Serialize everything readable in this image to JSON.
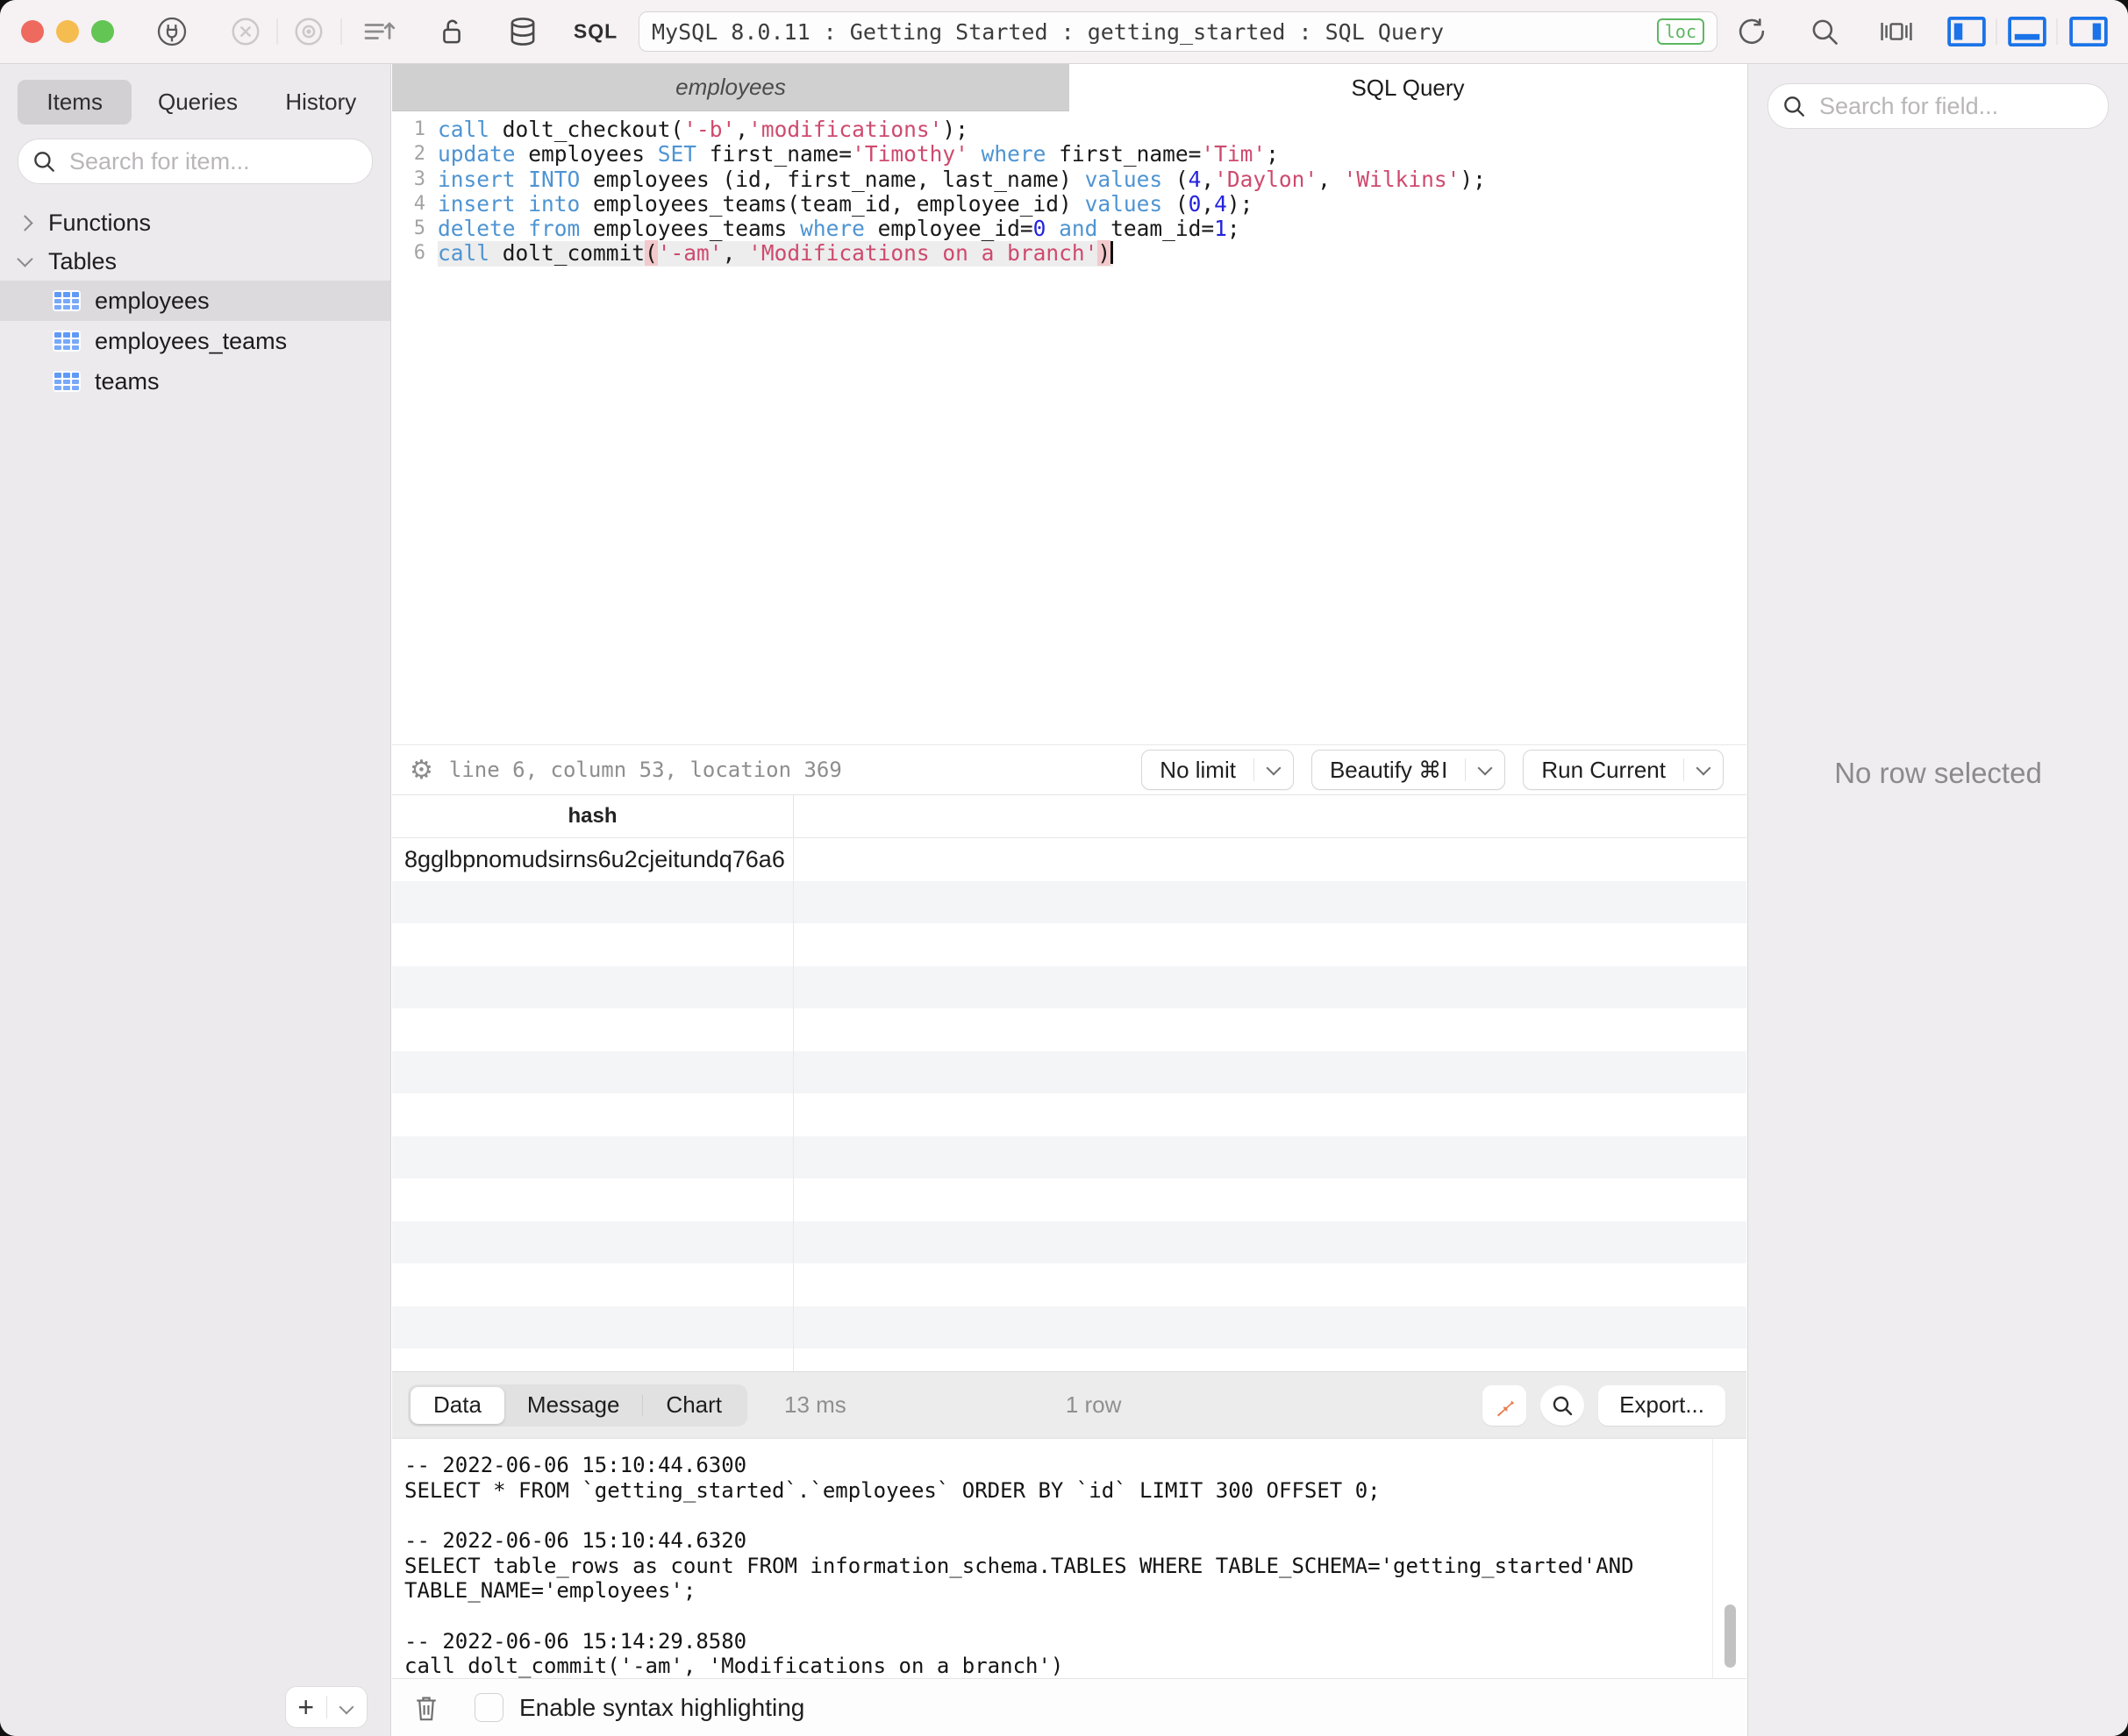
{
  "colors": {
    "kw": "#4e94d2",
    "str": "#ce4a6e",
    "num": "#2323dd",
    "parenbg": "#f3c9cc",
    "badge": "#5cb860",
    "accent": "#1a73e8",
    "pin": "#e87e52"
  },
  "window": {
    "title": "MySQL 8.0.11 : Getting Started : getting_started : SQL Query",
    "badge": "loc",
    "sql_glyph": "SQL"
  },
  "sidebar": {
    "tabs": [
      "Items",
      "Queries",
      "History"
    ],
    "active_tab": "Items",
    "search_placeholder": "Search for item...",
    "tree": [
      {
        "label": "Functions",
        "expanded": false,
        "children": []
      },
      {
        "label": "Tables",
        "expanded": true,
        "children": [
          {
            "label": "employees",
            "selected": true
          },
          {
            "label": "employees_teams",
            "selected": false
          },
          {
            "label": "teams",
            "selected": false
          }
        ]
      }
    ]
  },
  "editor": {
    "tabs": [
      {
        "label": "employees",
        "active": false
      },
      {
        "label": "SQL Query",
        "active": true
      }
    ],
    "status": "line 6, column 53, location 369",
    "buttons": [
      {
        "label": "No limit"
      },
      {
        "label": "Beautify ⌘I"
      },
      {
        "label": "Run Current"
      }
    ],
    "lines": [
      {
        "n": 1,
        "current": false,
        "tokens": [
          {
            "t": "kw",
            "v": "call"
          },
          {
            "t": "txt",
            "v": " dolt_checkout("
          },
          {
            "t": "str",
            "v": "'-b'"
          },
          {
            "t": "txt",
            "v": ","
          },
          {
            "t": "str",
            "v": "'modifications'"
          },
          {
            "t": "txt",
            "v": ");"
          }
        ]
      },
      {
        "n": 2,
        "current": false,
        "tokens": [
          {
            "t": "kw",
            "v": "update"
          },
          {
            "t": "txt",
            "v": " employees "
          },
          {
            "t": "kw",
            "v": "SET"
          },
          {
            "t": "txt",
            "v": " first_name="
          },
          {
            "t": "str",
            "v": "'Timothy'"
          },
          {
            "t": "txt",
            "v": " "
          },
          {
            "t": "kw",
            "v": "where"
          },
          {
            "t": "txt",
            "v": " first_name="
          },
          {
            "t": "str",
            "v": "'Tim'"
          },
          {
            "t": "txt",
            "v": ";"
          }
        ]
      },
      {
        "n": 3,
        "current": false,
        "tokens": [
          {
            "t": "kw",
            "v": "insert"
          },
          {
            "t": "txt",
            "v": " "
          },
          {
            "t": "kw",
            "v": "INTO"
          },
          {
            "t": "txt",
            "v": " employees (id, first_name, last_name) "
          },
          {
            "t": "kw",
            "v": "values"
          },
          {
            "t": "txt",
            "v": " ("
          },
          {
            "t": "num",
            "v": "4"
          },
          {
            "t": "txt",
            "v": ","
          },
          {
            "t": "str",
            "v": "'Daylon'"
          },
          {
            "t": "txt",
            "v": ", "
          },
          {
            "t": "str",
            "v": "'Wilkins'"
          },
          {
            "t": "txt",
            "v": ");"
          }
        ]
      },
      {
        "n": 4,
        "current": false,
        "tokens": [
          {
            "t": "kw",
            "v": "insert"
          },
          {
            "t": "txt",
            "v": " "
          },
          {
            "t": "kw",
            "v": "into"
          },
          {
            "t": "txt",
            "v": " employees_teams(team_id, employee_id) "
          },
          {
            "t": "kw",
            "v": "values"
          },
          {
            "t": "txt",
            "v": " ("
          },
          {
            "t": "num",
            "v": "0"
          },
          {
            "t": "txt",
            "v": ","
          },
          {
            "t": "num",
            "v": "4"
          },
          {
            "t": "txt",
            "v": ");"
          }
        ]
      },
      {
        "n": 5,
        "current": false,
        "tokens": [
          {
            "t": "kw",
            "v": "delete"
          },
          {
            "t": "txt",
            "v": " "
          },
          {
            "t": "kw",
            "v": "from"
          },
          {
            "t": "txt",
            "v": " employees_teams "
          },
          {
            "t": "kw",
            "v": "where"
          },
          {
            "t": "txt",
            "v": " employee_id="
          },
          {
            "t": "num",
            "v": "0"
          },
          {
            "t": "txt",
            "v": " "
          },
          {
            "t": "kw",
            "v": "and"
          },
          {
            "t": "txt",
            "v": " team_id="
          },
          {
            "t": "num",
            "v": "1"
          },
          {
            "t": "txt",
            "v": ";"
          }
        ]
      },
      {
        "n": 6,
        "current": true,
        "tokens": [
          {
            "t": "kw",
            "v": "call"
          },
          {
            "t": "txt",
            "v": " dolt_commit"
          },
          {
            "t": "par",
            "v": "("
          },
          {
            "t": "str",
            "v": "'-am'"
          },
          {
            "t": "txt",
            "v": ", "
          },
          {
            "t": "str",
            "v": "'Modifications on a branch'"
          },
          {
            "t": "par",
            "v": ")"
          }
        ]
      }
    ]
  },
  "results": {
    "columns": [
      "hash",
      ""
    ],
    "rows": [
      [
        "8gglbpnomudsirns6u2cjeitundq76a6",
        ""
      ]
    ],
    "empty_row_count": 12
  },
  "footer": {
    "tabs": [
      "Data",
      "Message",
      "Chart"
    ],
    "active_tab": "Data",
    "duration": "13 ms",
    "row_count": "1 row",
    "export_label": "Export..."
  },
  "log": {
    "entries": [
      {
        "time": "-- 2022-06-06 15:10:44.6300",
        "sql": "SELECT * FROM `getting_started`.`employees` ORDER BY `id` LIMIT 300 OFFSET 0;"
      },
      {
        "time": "-- 2022-06-06 15:10:44.6320",
        "sql": "SELECT table_rows as count FROM information_schema.TABLES WHERE TABLE_SCHEMA='getting_started'AND TABLE_NAME='employees';"
      },
      {
        "time": "-- 2022-06-06 15:14:29.8580",
        "sql": "call dolt_commit('-am', 'Modifications on a branch')"
      }
    ]
  },
  "bottom": {
    "syntax_checkbox_label": "Enable syntax highlighting",
    "checked": false
  },
  "right_panel": {
    "search_placeholder": "Search for field...",
    "empty_message": "No row selected"
  }
}
